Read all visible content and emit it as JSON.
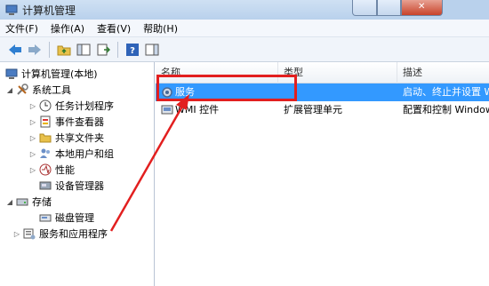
{
  "window": {
    "title": "计算机管理"
  },
  "menu": [
    "文件(F)",
    "操作(A)",
    "查看(V)",
    "帮助(H)"
  ],
  "tree": {
    "root": "计算机管理(本地)",
    "system_tools": "系统工具",
    "task_scheduler": "任务计划程序",
    "event_viewer": "事件查看器",
    "shared_folders": "共享文件夹",
    "local_users": "本地用户和组",
    "performance": "性能",
    "device_manager": "设备管理器",
    "storage": "存储",
    "disk_management": "磁盘管理",
    "services_apps": "服务和应用程序"
  },
  "list": {
    "headers": {
      "name": "名称",
      "type": "类型",
      "desc": "描述"
    },
    "rows": [
      {
        "name": "服务",
        "type": "",
        "desc": "启动、终止并设置 Wi"
      },
      {
        "name": "WMI 控件",
        "type": "扩展管理单元",
        "desc": "配置和控制 Window"
      }
    ]
  },
  "colors": {
    "selection": "#3399ff",
    "annotation": "#e21f1f"
  }
}
